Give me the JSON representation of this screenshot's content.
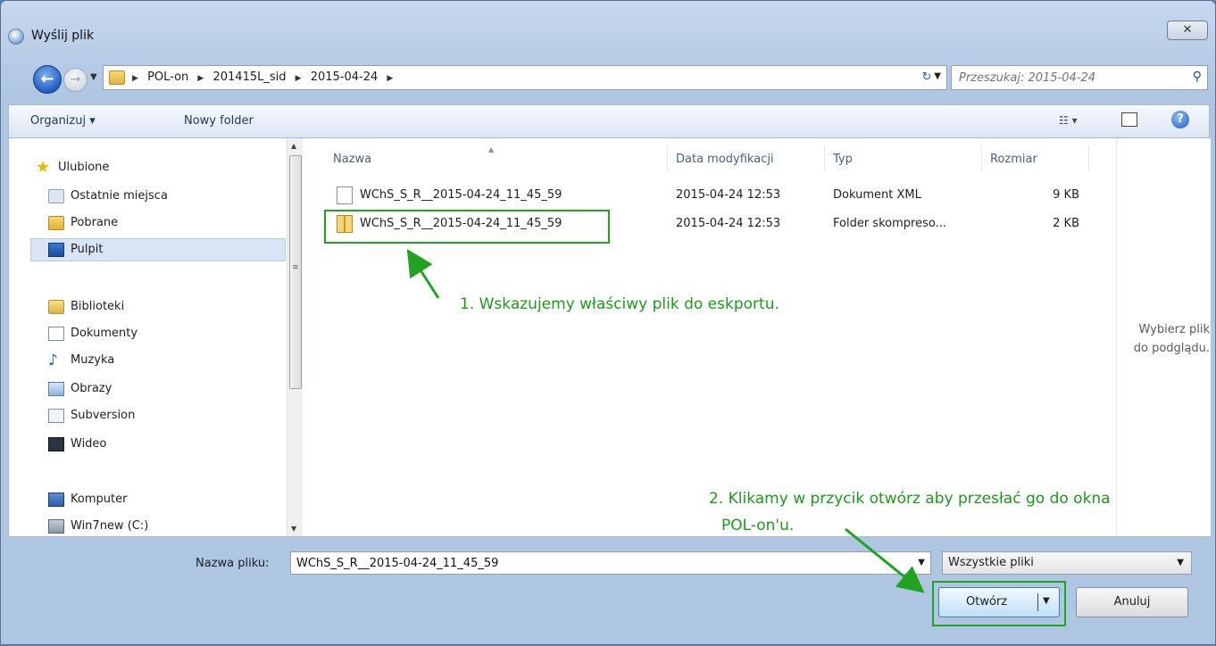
{
  "window": {
    "title": "Wyślij plik",
    "close_label": "✕"
  },
  "address": {
    "crumbs": [
      "POL-on",
      "201415L_sid",
      "2015-04-24"
    ]
  },
  "search": {
    "placeholder": "Przeszukaj: 2015-04-24"
  },
  "toolbar": {
    "organize_label": "Organizuj ▾",
    "new_folder_label": "Nowy folder"
  },
  "nav": {
    "favorites_header": "Ulubione",
    "favorites": [
      "Ostatnie miejsca",
      "Pobrane",
      "Pulpit"
    ],
    "libraries_header": "Biblioteki",
    "libraries": [
      "Dokumenty",
      "Muzyka",
      "Obrazy",
      "Subversion",
      "Wideo"
    ],
    "computer_header": "Komputer",
    "computer": [
      "Win7new (C:)"
    ],
    "selected": "Pulpit"
  },
  "columns": [
    "Nazwa",
    "Data modyfikacji",
    "Typ",
    "Rozmiar"
  ],
  "files": [
    {
      "name": "WChS_S_R__2015-04-24_11_45_59",
      "date": "2015-04-24 12:53",
      "type": "Dokument XML",
      "size": "9 KB",
      "icon": "xml-file-icon"
    },
    {
      "name": "WChS_S_R__2015-04-24_11_45_59",
      "date": "2015-04-24 12:53",
      "type": "Folder skompreso...",
      "size": "2 KB",
      "icon": "zip-folder-icon"
    }
  ],
  "preview": {
    "line1": "Wybierz plik",
    "line2": "do podglądu."
  },
  "filename": {
    "label": "Nazwa pliku:",
    "value": "WChS_S_R__2015-04-24_11_45_59"
  },
  "filter": {
    "value": "Wszystkie pliki"
  },
  "buttons": {
    "open": "Otwórz",
    "cancel": "Anuluj"
  },
  "annotations": {
    "step1": "1. Wskazujemy właściwy plik do eskportu.",
    "step2_line1": "2. Klikamy w przycik otwórz aby przesłać go do okna",
    "step2_line2": "POL-on'u."
  },
  "colors": {
    "annotation": "#21a321",
    "selection": "#d9e5f4"
  }
}
